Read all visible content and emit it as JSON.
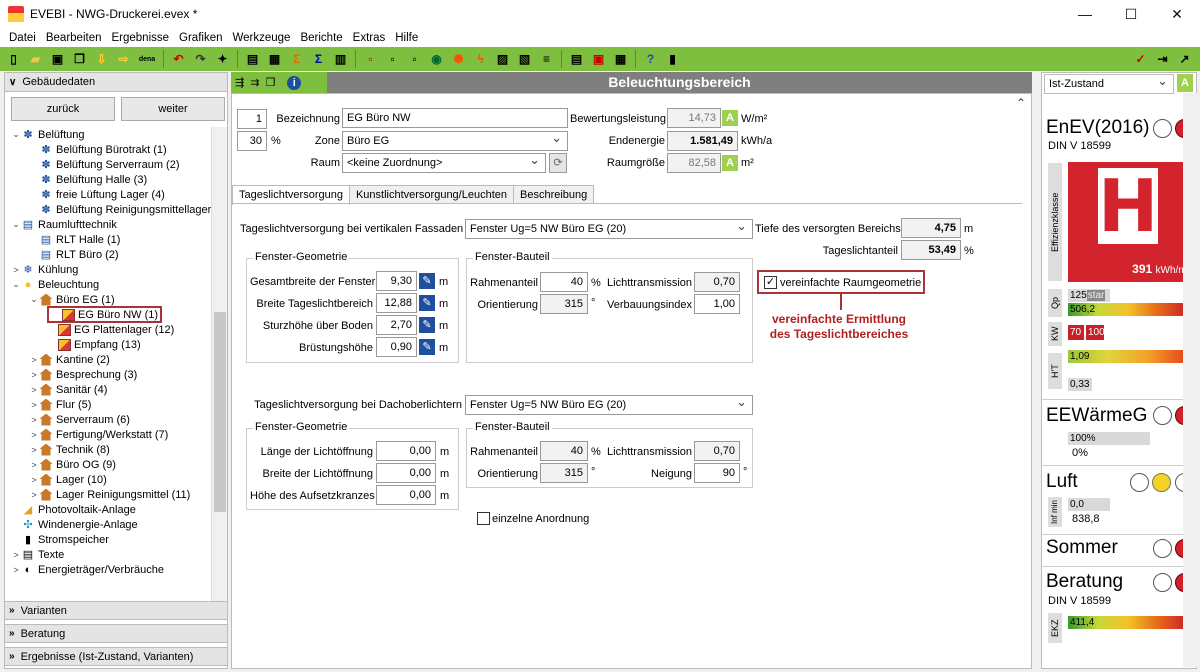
{
  "window": {
    "title": "EVEBI - NWG-Druckerei.evex *",
    "buttons": [
      "—",
      "☐",
      "✕"
    ]
  },
  "menu": [
    "Datei",
    "Bearbeiten",
    "Ergebnisse",
    "Grafiken",
    "Werkzeuge",
    "Berichte",
    "Extras",
    "Hilfe"
  ],
  "toolbar": {
    "dena": "dena"
  },
  "left": {
    "header": "Gebäudedaten",
    "back": "zurück",
    "forward": "weiter",
    "tree": [
      {
        "label": "Belüftung",
        "lvl": 0,
        "tw": "⌄",
        "icon": "fan-icon"
      },
      {
        "label": "Belüftung Bürotrakt (1)",
        "lvl": 1,
        "tw": "",
        "icon": "fan-icon"
      },
      {
        "label": "Belüftung Serverraum (2)",
        "lvl": 1,
        "tw": "",
        "icon": "fan-icon"
      },
      {
        "label": "Belüftung Halle (3)",
        "lvl": 1,
        "tw": "",
        "icon": "fan-icon"
      },
      {
        "label": "freie Lüftung Lager (4)",
        "lvl": 1,
        "tw": "",
        "icon": "fan-icon"
      },
      {
        "label": "Belüftung Reinigungsmittellager",
        "lvl": 1,
        "tw": "",
        "icon": "fan-icon"
      },
      {
        "label": "Raumlufttechnik",
        "lvl": 0,
        "tw": "⌄",
        "icon": "rlt-icon"
      },
      {
        "label": "RLT Halle (1)",
        "lvl": 1,
        "tw": "",
        "icon": "rlt-icon"
      },
      {
        "label": "RLT Büro (2)",
        "lvl": 1,
        "tw": "",
        "icon": "rlt-icon"
      },
      {
        "label": "Kühlung",
        "lvl": 0,
        "tw": ">",
        "icon": "snowflake-icon"
      },
      {
        "label": "Beleuchtung",
        "lvl": 0,
        "tw": "⌄",
        "icon": "bulb-icon"
      },
      {
        "label": "Büro EG (1)",
        "lvl": 1,
        "tw": "⌄",
        "icon": "house-icon"
      },
      {
        "label": "EG Büro NW (1)",
        "lvl": 2,
        "tw": "",
        "icon": "room-icon",
        "selected": true
      },
      {
        "label": "EG Plattenlager (12)",
        "lvl": 2,
        "tw": "",
        "icon": "room-icon"
      },
      {
        "label": "Empfang (13)",
        "lvl": 2,
        "tw": "",
        "icon": "room-icon"
      },
      {
        "label": "Kantine (2)",
        "lvl": 1,
        "tw": ">",
        "icon": "house-icon"
      },
      {
        "label": "Besprechung (3)",
        "lvl": 1,
        "tw": ">",
        "icon": "house-icon"
      },
      {
        "label": "Sanitär (4)",
        "lvl": 1,
        "tw": ">",
        "icon": "house-icon"
      },
      {
        "label": "Flur (5)",
        "lvl": 1,
        "tw": ">",
        "icon": "house-icon"
      },
      {
        "label": "Serverraum (6)",
        "lvl": 1,
        "tw": ">",
        "icon": "house-icon"
      },
      {
        "label": "Fertigung/Werkstatt (7)",
        "lvl": 1,
        "tw": ">",
        "icon": "house-icon"
      },
      {
        "label": "Technik (8)",
        "lvl": 1,
        "tw": ">",
        "icon": "house-icon"
      },
      {
        "label": "Büro OG (9)",
        "lvl": 1,
        "tw": ">",
        "icon": "house-icon"
      },
      {
        "label": "Lager (10)",
        "lvl": 1,
        "tw": ">",
        "icon": "house-icon"
      },
      {
        "label": "Lager Reinigungsmittel (11)",
        "lvl": 1,
        "tw": ">",
        "icon": "house-icon"
      },
      {
        "label": "Photovoltaik-Anlage",
        "lvl": 0,
        "tw": "",
        "icon": "pv-icon"
      },
      {
        "label": "Windenergie-Anlage",
        "lvl": 0,
        "tw": "",
        "icon": "wind-icon"
      },
      {
        "label": "Stromspeicher",
        "lvl": 0,
        "tw": "",
        "icon": "battery-icon"
      },
      {
        "label": "Texte",
        "lvl": 0,
        "tw": ">",
        "icon": "text-icon"
      },
      {
        "label": "Energieträger/Verbräuche",
        "lvl": 0,
        "tw": ">",
        "icon": "fuel-icon"
      }
    ],
    "sections": [
      "Varianten",
      "Beratung",
      "Ergebnisse (Ist-Zustand, Varianten)"
    ]
  },
  "main": {
    "title": "Beleuchtungsbereich",
    "number": "1",
    "percent": "30",
    "percent_unit": "%",
    "bez_label": "Bezeichnung",
    "bez_value": "EG Büro NW",
    "zone_label": "Zone",
    "zone_value": "Büro EG",
    "raum_label": "Raum",
    "raum_value": "<keine Zuordnung>",
    "bew_label": "Bewertungsleistung",
    "bew_value": "14,73",
    "bew_unit": "W/m²",
    "end_label": "Endenergie",
    "end_value": "1.581,49",
    "end_unit": "kWh/a",
    "rg_label": "Raumgröße",
    "rg_value": "82,58",
    "rg_unit": "m²",
    "a_badge": "A",
    "tabs": [
      "Tageslichtversorgung",
      "Kunstlichtversorgung/Leuchten",
      "Beschreibung"
    ],
    "vert": {
      "label": "Tageslichtversorgung bei vertikalen Fassaden",
      "value": "Fenster Ug=5 NW Büro EG (20)",
      "tiefe_label": "Tiefe des versorgten Bereichs",
      "tiefe_value": "4,75",
      "tiefe_unit": "m",
      "anteil_label": "Tageslichtanteil",
      "anteil_value": "53,49",
      "anteil_unit": "%",
      "geo_title": "Fenster-Geometrie",
      "geo": [
        {
          "label": "Gesamtbreite der Fenster",
          "value": "9,30",
          "unit": "m"
        },
        {
          "label": "Breite Tageslichtbereich",
          "value": "12,88",
          "unit": "m"
        },
        {
          "label": "Sturzhöhe über Boden",
          "value": "2,70",
          "unit": "m"
        },
        {
          "label": "Brüstungshöhe",
          "value": "0,90",
          "unit": "m"
        }
      ],
      "bt_title": "Fenster-Bauteil",
      "rahmen_label": "Rahmenanteil",
      "rahmen_value": "40",
      "rahmen_unit": "%",
      "orient_label": "Orientierung",
      "orient_value": "315",
      "orient_unit": "°",
      "licht_label": "Lichttransmission",
      "licht_value": "0,70",
      "verb_label": "Verbauungsindex",
      "verb_value": "1,00",
      "checkbox_label": "vereinfachte Raumgeometrie",
      "callout": "vereinfachte Ermittlung\ndes Tageslichtbereiches"
    },
    "dach": {
      "label": "Tageslichtversorgung bei Dachoberlichtern",
      "value": "Fenster Ug=5 NW Büro EG (20)",
      "geo_title": "Fenster-Geometrie",
      "geo": [
        {
          "label": "Länge der Lichtöffnung",
          "value": "0,00",
          "unit": "m"
        },
        {
          "label": "Breite der Lichtöffnung",
          "value": "0,00",
          "unit": "m"
        },
        {
          "label": "Höhe des Aufsetzkranzes",
          "value": "0,00",
          "unit": "m"
        }
      ],
      "bt_title": "Fenster-Bauteil",
      "rahmen_label": "Rahmenanteil",
      "rahmen_value": "40",
      "rahmen_unit": "%",
      "orient_label": "Orientierung",
      "orient_value": "315",
      "orient_unit": "°",
      "licht_label": "Lichttransmission",
      "licht_value": "0,70",
      "neig_label": "Neigung",
      "neig_value": "90",
      "neig_unit": "°",
      "checkbox_label": "einzelne Anordnung"
    }
  },
  "right": {
    "state": "Ist-Zustand",
    "enev": {
      "title": "EnEV(2016)",
      "sub": "DIN V 18599",
      "side": "Effizienzklasse",
      "letter": "H",
      "value": "391",
      "unit": "kWh/m²",
      "qp_label": "Qp",
      "qp1": "125",
      "qp1b": "star",
      "qp2": "506,2",
      "kw_label": "KW",
      "kw1": "70",
      "kw2": "100",
      "ht_label": "H'T",
      "ht1": "1,09",
      "ht2": "0,33"
    },
    "ee": {
      "title": "EEWärmeG",
      "v1": "100%",
      "v2": "0%"
    },
    "luft": {
      "title": "Luft",
      "side": "Inf min",
      "v1": "0,0",
      "v2": "838,8"
    },
    "sommer": {
      "title": "Sommer"
    },
    "beratung": {
      "title": "Beratung",
      "sub": "DIN V 18599",
      "side": "EKZ",
      "v1": "411,4"
    }
  }
}
